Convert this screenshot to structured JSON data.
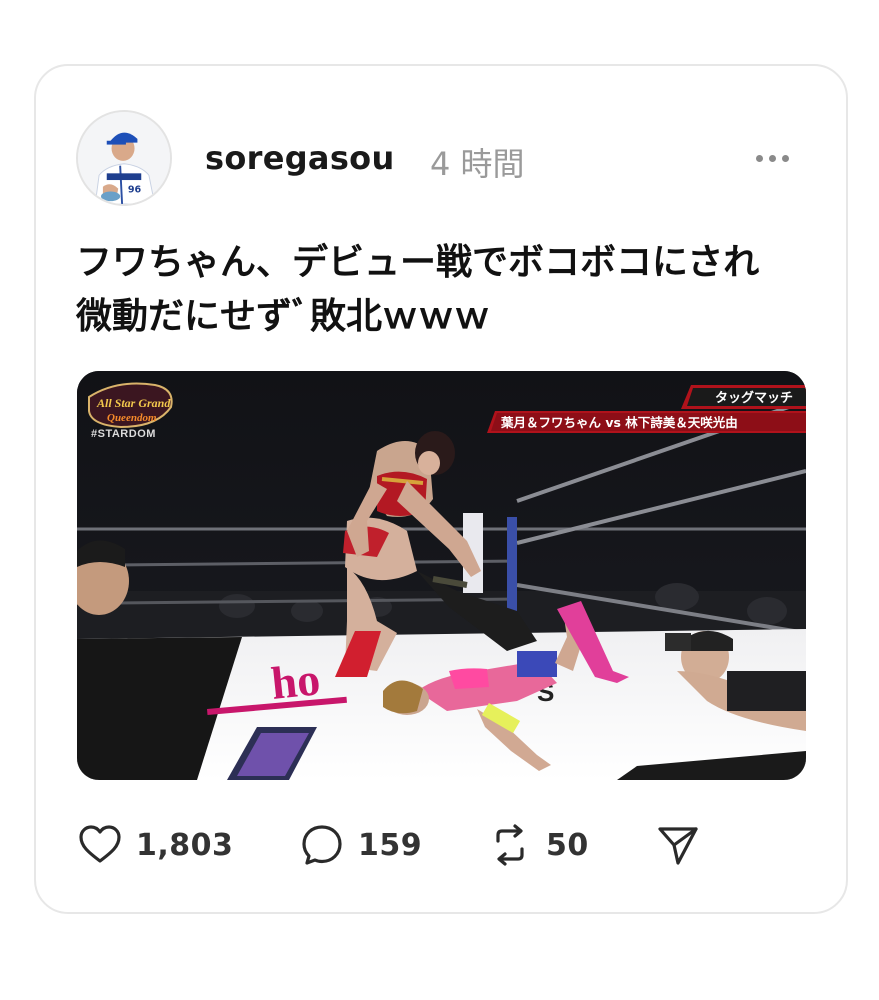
{
  "post": {
    "username": "soregasou",
    "time": "4 時間",
    "text_lines": [
      "フワちゃん、デビュー戦でボコボコにされ",
      "微動だにせずﾞ敗北ｗｗｗ"
    ]
  },
  "media": {
    "logo_text": "All Star Grand Queendom",
    "hashtag": "#STARDOM",
    "match_type": "タッグマッチ",
    "matchup": "葉月＆フワちゃん vs 林下詩美＆天咲光由",
    "mat_text": "ho",
    "apron_text": "S"
  },
  "actions": {
    "likes": "1,803",
    "comments": "159",
    "reposts": "50"
  },
  "colors": {
    "accent_red": "#b0121b",
    "card_border": "#e7e7e7",
    "muted": "#9a9a9a"
  },
  "icons": [
    "more-icon",
    "heart-icon",
    "comment-icon",
    "repost-icon",
    "share-icon"
  ]
}
